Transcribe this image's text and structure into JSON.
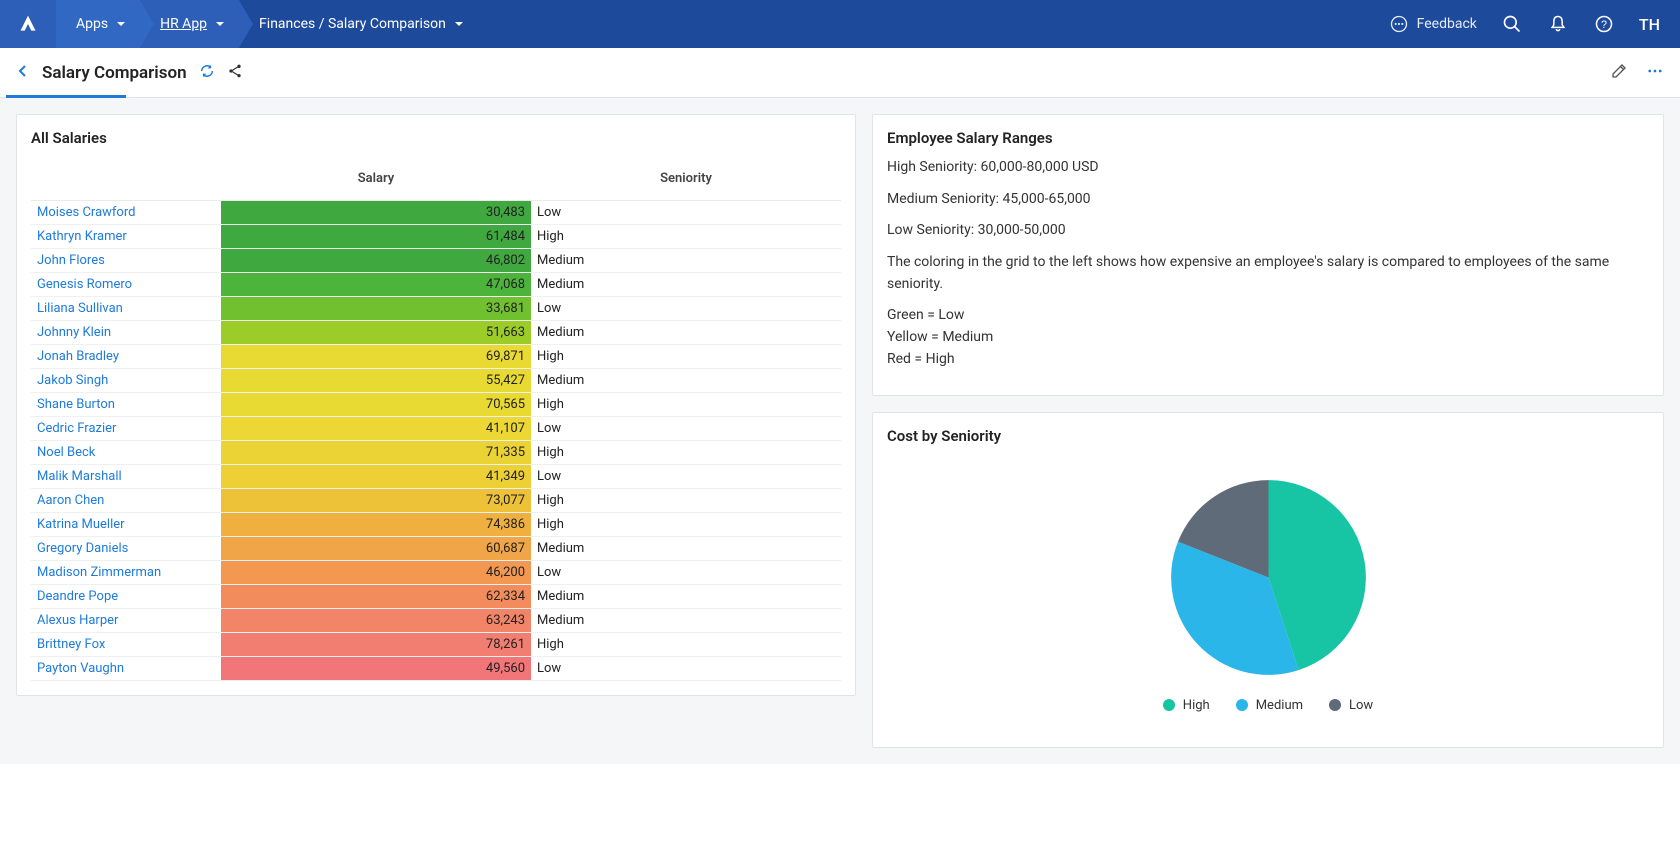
{
  "topnav": {
    "apps_label": "Apps",
    "app_name": "HR App",
    "breadcrumb": "Finances / Salary Comparison",
    "feedback_label": "Feedback",
    "user_initials": "TH"
  },
  "page": {
    "title": "Salary Comparison"
  },
  "all_salaries": {
    "title": "All Salaries",
    "columns": {
      "salary": "Salary",
      "seniority": "Seniority"
    },
    "rows": [
      {
        "name": "Moises Crawford",
        "salary": "30,483",
        "seniority": "Low",
        "bg": "#3fa83f"
      },
      {
        "name": "Kathryn Kramer",
        "salary": "61,484",
        "seniority": "High",
        "bg": "#3fa83f"
      },
      {
        "name": "John Flores",
        "salary": "46,802",
        "seniority": "Medium",
        "bg": "#3fa83f"
      },
      {
        "name": "Genesis Romero",
        "salary": "47,068",
        "seniority": "Medium",
        "bg": "#4cb43a"
      },
      {
        "name": "Liliana Sullivan",
        "salary": "33,681",
        "seniority": "Low",
        "bg": "#70c030"
      },
      {
        "name": "Johnny Klein",
        "salary": "51,663",
        "seniority": "Medium",
        "bg": "#9ccc28"
      },
      {
        "name": "Jonah Bradley",
        "salary": "69,871",
        "seniority": "High",
        "bg": "#e8da33"
      },
      {
        "name": "Jakob Singh",
        "salary": "55,427",
        "seniority": "Medium",
        "bg": "#e8da33"
      },
      {
        "name": "Shane Burton",
        "salary": "70,565",
        "seniority": "High",
        "bg": "#e8da33"
      },
      {
        "name": "Cedric Frazier",
        "salary": "41,107",
        "seniority": "Low",
        "bg": "#ecd735"
      },
      {
        "name": "Noel Beck",
        "salary": "71,335",
        "seniority": "High",
        "bg": "#ecd335"
      },
      {
        "name": "Malik Marshall",
        "salary": "41,349",
        "seniority": "Low",
        "bg": "#ecd035"
      },
      {
        "name": "Aaron Chen",
        "salary": "73,077",
        "seniority": "High",
        "bg": "#eec238"
      },
      {
        "name": "Katrina Mueller",
        "salary": "74,386",
        "seniority": "High",
        "bg": "#f0b040"
      },
      {
        "name": "Gregory Daniels",
        "salary": "60,687",
        "seniority": "Medium",
        "bg": "#f0a548"
      },
      {
        "name": "Madison Zimmerman",
        "salary": "46,200",
        "seniority": "Low",
        "bg": "#f29850"
      },
      {
        "name": "Deandre Pope",
        "salary": "62,334",
        "seniority": "Medium",
        "bg": "#f28c5c"
      },
      {
        "name": "Alexus Harper",
        "salary": "63,243",
        "seniority": "Medium",
        "bg": "#f28468"
      },
      {
        "name": "Brittney Fox",
        "salary": "78,261",
        "seniority": "High",
        "bg": "#f27e72"
      },
      {
        "name": "Payton Vaughn",
        "salary": "49,560",
        "seniority": "Low",
        "bg": "#f27678"
      }
    ]
  },
  "ranges": {
    "title": "Employee Salary Ranges",
    "p1": "High Seniority: 60,000-80,000 USD",
    "p2": "Medium Seniority: 45,000-65,000",
    "p3": "Low Seniority: 30,000-50,000",
    "p4": "The coloring in the grid to the left shows how expensive an employee's salary is compared to employees of the same seniority.",
    "p5": "Green = Low",
    "p6": "Yellow = Medium",
    "p7": "Red = High"
  },
  "pie_card": {
    "title": "Cost by Seniority",
    "legend": {
      "high": "High",
      "medium": "Medium",
      "low": "Low"
    }
  },
  "chart_data": {
    "type": "pie",
    "title": "Cost by Seniority",
    "series": [
      {
        "name": "High",
        "value": 45,
        "color": "#17c4a3"
      },
      {
        "name": "Medium",
        "value": 36,
        "color": "#2ab6e8"
      },
      {
        "name": "Low",
        "value": 19,
        "color": "#5f6b78"
      }
    ]
  }
}
